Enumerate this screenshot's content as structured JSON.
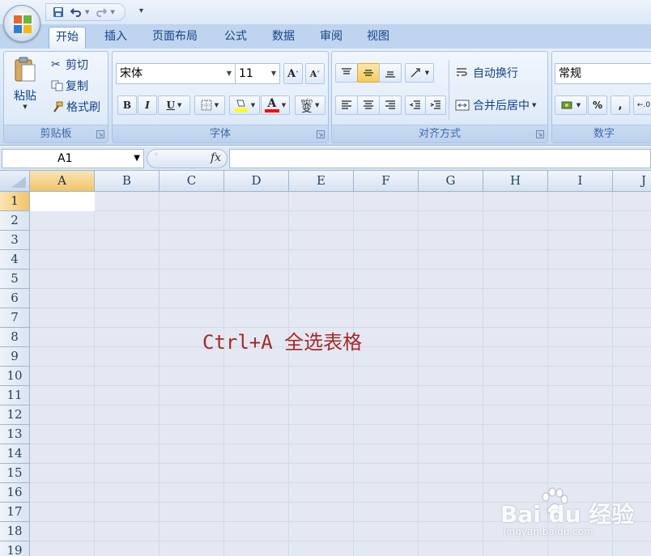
{
  "qat": {
    "customize": "▾"
  },
  "tabs": [
    {
      "label": "开始",
      "active": true
    },
    {
      "label": "插入"
    },
    {
      "label": "页面布局"
    },
    {
      "label": "公式"
    },
    {
      "label": "数据"
    },
    {
      "label": "审阅"
    },
    {
      "label": "视图"
    }
  ],
  "clipboard": {
    "paste": "粘贴",
    "cut": "剪切",
    "copy": "复制",
    "format_painter": "格式刷",
    "label": "剪贴板"
  },
  "font": {
    "name": "宋体",
    "size": "11",
    "grow": "A",
    "shrink": "A",
    "bold": "B",
    "italic": "I",
    "underline": "U",
    "font_color_letter": "A",
    "phonetic": "wén",
    "phonetic_char": "变",
    "label": "字体"
  },
  "alignment": {
    "wrap_text": "自动换行",
    "merge_center": "合并后居中",
    "label": "对齐方式"
  },
  "number": {
    "format": "常规",
    "percent": "%",
    "comma": ",",
    "label": "数字"
  },
  "formula_bar": {
    "name_box": "A1",
    "fx": "fx",
    "value": ""
  },
  "sheet": {
    "columns": [
      "A",
      "B",
      "C",
      "D",
      "E",
      "F",
      "G",
      "H",
      "I",
      "J"
    ],
    "rows": [
      "1",
      "2",
      "3",
      "4",
      "5",
      "6",
      "7",
      "8",
      "9",
      "10",
      "11",
      "12",
      "13",
      "14",
      "15",
      "16",
      "17",
      "18",
      "19"
    ]
  },
  "annotation": "Ctrl+A 全选表格",
  "watermark": {
    "brand": "Bai du 经验",
    "url": "jingyan.baidu.com"
  },
  "colors": {
    "annotation": "#a52a2a",
    "selection": "#f1c46a",
    "sheet_bg": "#e4e8f2"
  }
}
